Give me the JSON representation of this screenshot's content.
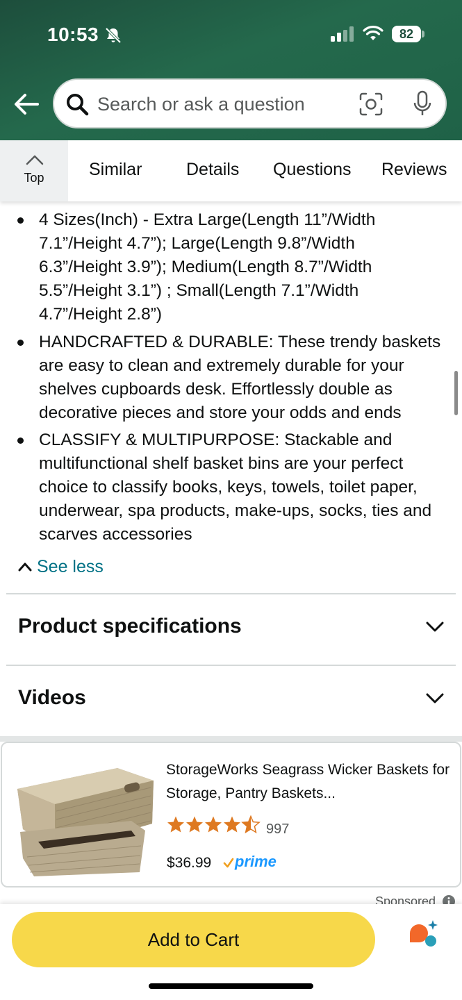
{
  "status_bar": {
    "time": "10:53",
    "battery": "82"
  },
  "search": {
    "placeholder": "Search or ask a question"
  },
  "tabs": {
    "top_label": "Top",
    "items": [
      "Similar",
      "Details",
      "Questions",
      "Reviews"
    ]
  },
  "bullets": [
    "4 Sizes(Inch) - Extra Large(Length 11”/Width 7.1”/Height 4.7”); Large(Length 9.8”/Width 6.3”/Height 3.9”); Medium(Length 8.7”/Width 5.5”/Height 3.1”) ; Small(Length 7.1”/Width 4.7”/Height 2.8”)",
    "HANDCRAFTED & DURABLE: These trendy baskets are easy to clean and extremely durable for your shelves cupboards desk. Effortlessly double as decorative pieces and store your odds and ends",
    "CLASSIFY & MULTIPURPOSE: Stackable and multifunctional shelf basket bins are your perfect choice to classify books, keys, towels, toilet paper, underwear, spa products, make-ups, socks, ties and scarves accessories"
  ],
  "see_less": "See less",
  "sections": {
    "specifications": "Product specifications",
    "videos": "Videos"
  },
  "ad": {
    "title": "StorageWorks Seagrass Wicker Baskets for Storage, Pantry Baskets...",
    "rating": 4.5,
    "review_count": "997",
    "price": "$36.99",
    "prime": "prime"
  },
  "sponsored": "Sponsored",
  "cart": {
    "add_to_cart": "Add to Cart"
  },
  "colors": {
    "header_green": "#1f6247",
    "link_teal": "#007185",
    "cart_yellow": "#f7d84a",
    "star_orange": "#de7921",
    "prime_blue": "#1a98ff"
  }
}
